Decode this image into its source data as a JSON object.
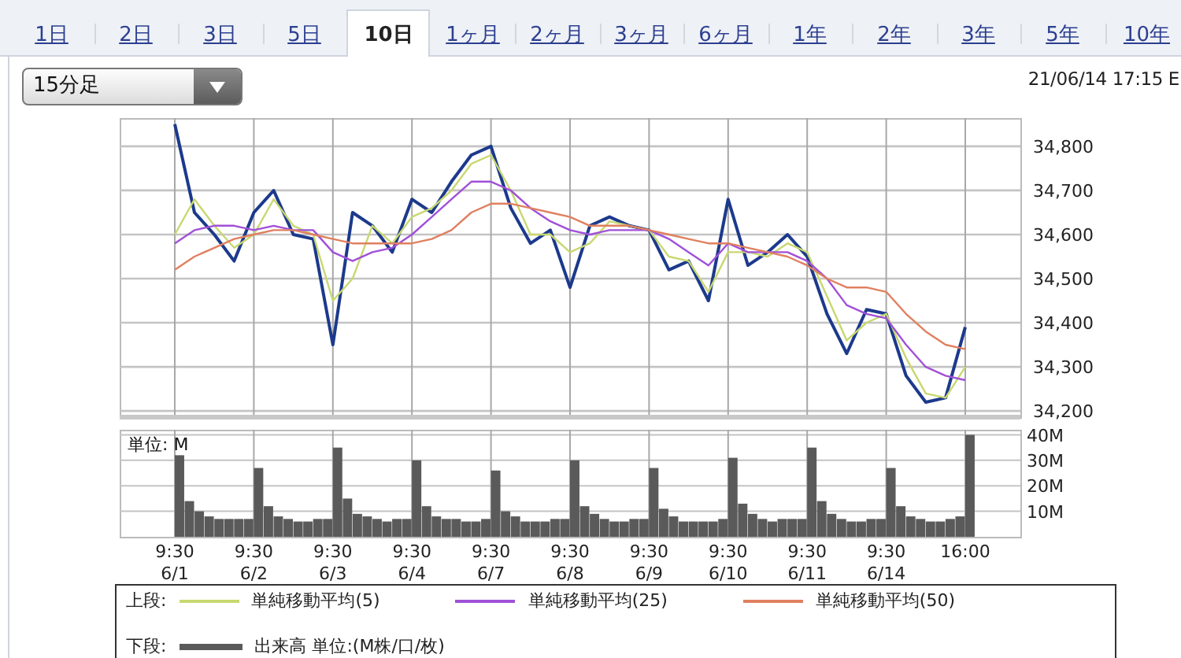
{
  "tabs": [
    {
      "label": "1日",
      "selected": false
    },
    {
      "label": "2日",
      "selected": false
    },
    {
      "label": "3日",
      "selected": false
    },
    {
      "label": "5日",
      "selected": false
    },
    {
      "label": "10日",
      "selected": true
    },
    {
      "label": "1ヶ月",
      "selected": false
    },
    {
      "label": "2ヶ月",
      "selected": false
    },
    {
      "label": "3ヶ月",
      "selected": false
    },
    {
      "label": "6ヶ月",
      "selected": false
    },
    {
      "label": "1年",
      "selected": false
    },
    {
      "label": "2年",
      "selected": false
    },
    {
      "label": "3年",
      "selected": false
    },
    {
      "label": "5年",
      "selected": false
    },
    {
      "label": "10年",
      "selected": false
    }
  ],
  "interval_select": {
    "value": "15分足"
  },
  "timestamp": "21/06/14 17:15 E",
  "price_chart": {
    "legend_label": "上段:",
    "chart_data": {
      "type": "line",
      "grid": true,
      "ylim": [
        34186,
        34864
      ],
      "yticks": [
        {
          "value": 34200,
          "label": "34,200"
        },
        {
          "value": 34300,
          "label": "34,300"
        },
        {
          "value": 34400,
          "label": "34,400"
        },
        {
          "value": 34500,
          "label": "34,500"
        },
        {
          "value": 34600,
          "label": "34,600"
        },
        {
          "value": 34700,
          "label": "34,700"
        },
        {
          "value": 34800,
          "label": "34,800"
        }
      ],
      "series": [
        {
          "color": "#1c3a8c",
          "values": [
            34850,
            34650,
            34600,
            34540,
            34650,
            34700,
            34600,
            34590,
            34350,
            34650,
            34620,
            34560,
            34680,
            34650,
            34720,
            34780,
            34800,
            34660,
            34580,
            34610,
            34480,
            34620,
            34640,
            34620,
            34610,
            34520,
            34540,
            34450,
            34680,
            34530,
            34560,
            34600,
            34550,
            34420,
            34330,
            34430,
            34420,
            34280,
            34220,
            34230,
            34390
          ]
        },
        {
          "name": "単純移動平均(5)",
          "color": "#c8d870",
          "values": [
            34600,
            34680,
            34620,
            34570,
            34600,
            34680,
            34620,
            34600,
            34450,
            34500,
            34620,
            34580,
            34640,
            34660,
            34700,
            34760,
            34780,
            34700,
            34600,
            34600,
            34560,
            34580,
            34630,
            34620,
            34610,
            34550,
            34540,
            34470,
            34560,
            34560,
            34550,
            34580,
            34560,
            34460,
            34360,
            34400,
            34420,
            34320,
            34240,
            34230,
            34300
          ]
        },
        {
          "name": "単純移動平均(25)",
          "color": "#a050d8",
          "values": [
            34580,
            34610,
            34620,
            34620,
            34610,
            34620,
            34610,
            34610,
            34560,
            34540,
            34560,
            34570,
            34600,
            34640,
            34680,
            34720,
            34720,
            34700,
            34660,
            34630,
            34610,
            34600,
            34610,
            34610,
            34610,
            34590,
            34560,
            34530,
            34580,
            34560,
            34560,
            34560,
            34540,
            34500,
            34440,
            34420,
            34410,
            34350,
            34300,
            34280,
            34270
          ]
        },
        {
          "name": "単純移動平均(50)",
          "color": "#e08060",
          "values": [
            34520,
            34550,
            34570,
            34590,
            34600,
            34610,
            34610,
            34600,
            34590,
            34580,
            34580,
            34580,
            34580,
            34590,
            34610,
            34650,
            34670,
            34670,
            34660,
            34650,
            34640,
            34620,
            34620,
            34620,
            34610,
            34600,
            34590,
            34580,
            34580,
            34570,
            34560,
            34550,
            34530,
            34500,
            34480,
            34480,
            34470,
            34420,
            34380,
            34350,
            34340
          ]
        }
      ]
    }
  },
  "volume_chart": {
    "unit_label": "単位: M",
    "legend_label": "下段:",
    "chart_data": {
      "type": "bar",
      "grid": true,
      "ylim": [
        0,
        42
      ],
      "yticks": [
        {
          "value": 10,
          "label": "10M"
        },
        {
          "value": 20,
          "label": "20M"
        },
        {
          "value": 30,
          "label": "30M"
        },
        {
          "value": 40,
          "label": "40M"
        }
      ],
      "series": [
        {
          "name": "出来高 単位:(M株/口/枚)",
          "color": "#5a5a5a",
          "values": [
            32,
            14,
            10,
            8,
            7,
            7,
            7,
            7,
            27,
            12,
            8,
            7,
            6,
            6,
            7,
            7,
            35,
            15,
            9,
            8,
            7,
            6,
            7,
            7,
            30,
            12,
            8,
            7,
            7,
            6,
            6,
            7,
            26,
            10,
            8,
            6,
            6,
            6,
            7,
            7,
            30,
            12,
            9,
            7,
            6,
            6,
            7,
            7,
            27,
            11,
            8,
            6,
            6,
            6,
            6,
            7,
            31,
            13,
            9,
            7,
            6,
            7,
            7,
            7,
            35,
            14,
            9,
            7,
            6,
            6,
            7,
            7,
            27,
            12,
            8,
            7,
            6,
            6,
            7,
            8,
            40
          ]
        }
      ]
    }
  },
  "time_axis": [
    {
      "time": "9:30",
      "date": "6/1"
    },
    {
      "time": "9:30",
      "date": "6/2"
    },
    {
      "time": "9:30",
      "date": "6/3"
    },
    {
      "time": "9:30",
      "date": "6/4"
    },
    {
      "time": "9:30",
      "date": "6/7"
    },
    {
      "time": "9:30",
      "date": "6/8"
    },
    {
      "time": "9:30",
      "date": "6/9"
    },
    {
      "time": "9:30",
      "date": "6/10"
    },
    {
      "time": "9:30",
      "date": "6/11"
    },
    {
      "time": "9:30",
      "date": "6/14"
    },
    {
      "time": "16:00"
    }
  ]
}
